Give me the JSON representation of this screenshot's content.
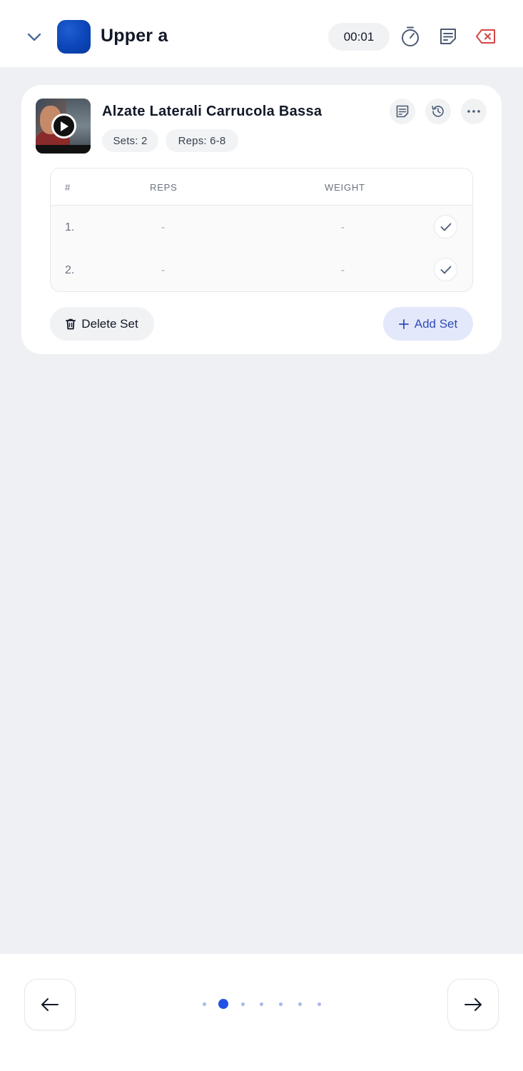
{
  "header": {
    "title": "Upper a",
    "timer": "00:01",
    "icons": [
      "chevron-down-icon",
      "stopwatch-icon",
      "notes-icon",
      "close-workout-icon"
    ],
    "colors": {
      "avatar": "#0b45b8",
      "close": "#d64545"
    }
  },
  "exercise": {
    "name": "Alzate Laterali Carrucola Bassa",
    "sets_chip": "Sets: 2",
    "reps_chip": "Reps: 6-8",
    "icons": [
      "play-icon",
      "notes-icon",
      "history-icon",
      "more-icon"
    ]
  },
  "table": {
    "headers": {
      "index": "#",
      "reps": "REPS",
      "weight": "WEIGHT"
    },
    "rows": [
      {
        "index": "1.",
        "reps": "-",
        "weight": "-"
      },
      {
        "index": "2.",
        "reps": "-",
        "weight": "-"
      }
    ]
  },
  "actions": {
    "delete_label": "Delete Set",
    "add_label": "Add Set"
  },
  "pagination": {
    "total": 7,
    "active_index": 1
  },
  "footer": {
    "icons": [
      "arrow-left-icon",
      "arrow-right-icon"
    ]
  },
  "colors": {
    "accent": "#2450e6",
    "add_bg": "#e3e8fb",
    "page_bg": "#eef0f4"
  }
}
